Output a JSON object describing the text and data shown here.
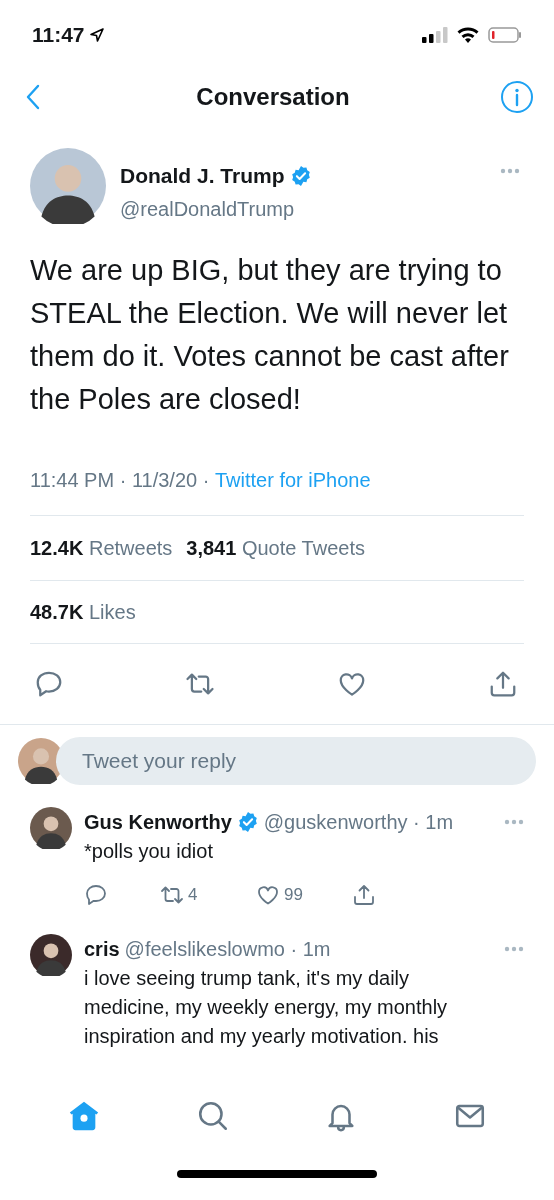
{
  "status_bar": {
    "time": "11:47"
  },
  "nav": {
    "title": "Conversation"
  },
  "tweet": {
    "name": "Donald J. Trump",
    "verified": true,
    "handle": "@realDonaldTrump",
    "text": "We are up BIG, but they are trying to STEAL the Election. We will never let them do it. Votes cannot be cast after the Poles are closed!",
    "time": "11:44 PM · 11/3/20 · ",
    "source": "Twitter for iPhone",
    "stats": [
      {
        "count": "12.4K",
        "label": "Retweets"
      },
      {
        "count": "3,841",
        "label": "Quote Tweets"
      }
    ],
    "likes": {
      "count": "48.7K",
      "label": "Likes"
    }
  },
  "reply_field": {
    "placeholder": "Tweet your reply"
  },
  "replies": [
    {
      "name": "Gus Kenworthy",
      "verified": true,
      "handle": "@guskenworthy · 1m",
      "lines": [
        "*polls you idiot"
      ],
      "actions": {
        "retweets": "4",
        "likes": "99"
      }
    },
    {
      "name": "cris",
      "verified": false,
      "handle": "@feelslikeslowmo · 1m",
      "lines": [
        "i love seeing trump tank, it's my daily",
        "medicine, my weekly energy, my monthly",
        "inspiration and my yearly motivation. his"
      ]
    }
  ],
  "tab_bar": [
    {
      "kind": "home",
      "selected": true
    },
    {
      "kind": "search",
      "selected": false
    },
    {
      "kind": "bell",
      "selected": false
    },
    {
      "kind": "mail",
      "selected": false
    }
  ]
}
